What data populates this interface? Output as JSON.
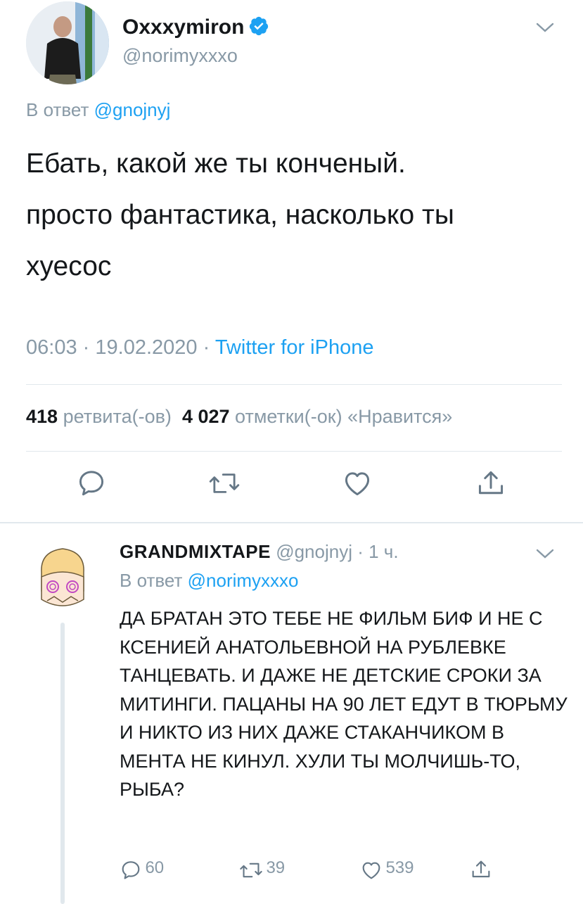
{
  "main_tweet": {
    "author": {
      "name": "Oxxxymiron",
      "handle": "@norimyxxxo",
      "verified": true,
      "avatar_icon": "avatar-photo"
    },
    "reply_prefix": "В ответ",
    "reply_to": "@gnojnyj",
    "text": "Ебать, какой же ты конченый.\nпросто фантастика, насколько ты\nхуесос",
    "time": "06:03",
    "date": "19.02.2020",
    "source": "Twitter for iPhone",
    "stats": {
      "retweets": "418",
      "retweets_label": "ретвита(-ов)",
      "likes": "4 027",
      "likes_label": "отметки(-ок) «Нравится»"
    },
    "actions": [
      "reply-icon",
      "retweet-icon",
      "like-icon",
      "share-icon"
    ]
  },
  "reply_tweet": {
    "author": {
      "name": "GRANDMIXTAPE",
      "handle": "@gnojnyj",
      "age": "1 ч.",
      "avatar_icon": "cartoon-avatar"
    },
    "reply_prefix": "В ответ",
    "reply_to": "@norimyxxxo",
    "text": "ДА БРАТАН ЭТО ТЕБЕ НЕ ФИЛЬМ БИФ И НЕ С КСЕНИЕЙ АНАТОЛЬЕВНОЙ НА РУБЛЕВКЕ ТАНЦЕВАТЬ. И ДАЖЕ НЕ ДЕТСКИЕ СРОКИ ЗА МИТИНГИ. ПАЦАНЫ НА 90 ЛЕТ ЕДУТ В ТЮРЬМУ И НИКТО ИЗ НИХ ДАЖЕ СТАКАНЧИКОМ В МЕНТА НЕ КИНУЛ. ХУЛИ ТЫ МОЛЧИШЬ-ТО, РЫБА?",
    "counts": {
      "replies": "60",
      "retweets": "39",
      "likes": "539"
    }
  },
  "colors": {
    "accent": "#1da1f2",
    "secondary_text": "#8899a6",
    "divider": "#e1e8ed"
  }
}
